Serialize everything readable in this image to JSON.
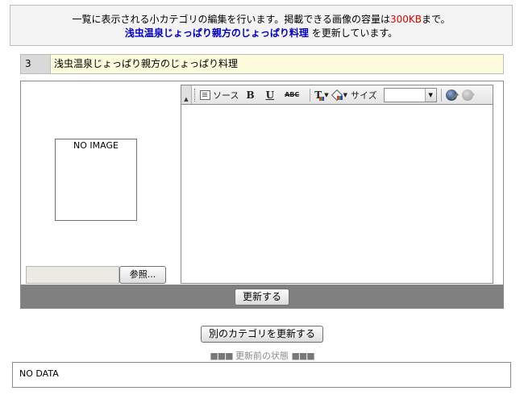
{
  "info": {
    "line1_prefix": "一覧に表示される小カテゴリの編集を行います。掲載できる画像の容量は",
    "size_limit": "300KB",
    "line1_suffix": "まで。",
    "category_name": "浅虫温泉じょっぱり親方のじょっぱり料理",
    "line2_suffix": " を更新しています。"
  },
  "title_row": {
    "number": "3",
    "name": "浅虫温泉じょっぱり親方のじょっぱり料理"
  },
  "image_panel": {
    "placeholder": "NO IMAGE",
    "browse_label": "参照..."
  },
  "toolbar": {
    "collapse_icon": "triangle-up-icon",
    "source_label": "ソース",
    "bold_label": "B",
    "underline_label": "U",
    "strike_label": "ABC",
    "text_color_label": "T",
    "size_label": "サイズ",
    "size_value": ""
  },
  "form": {
    "update_label": "更新する",
    "other_category_label": "別のカテゴリを更新する"
  },
  "previous_state": {
    "squares": "■■■",
    "heading": " 更新前の状態 ",
    "content": "NO DATA"
  },
  "colors": {
    "size_highlight": "#e00000",
    "category_name": "#0000cc",
    "submit_bar": "#808080",
    "title_bg": "#fcfbdc"
  }
}
